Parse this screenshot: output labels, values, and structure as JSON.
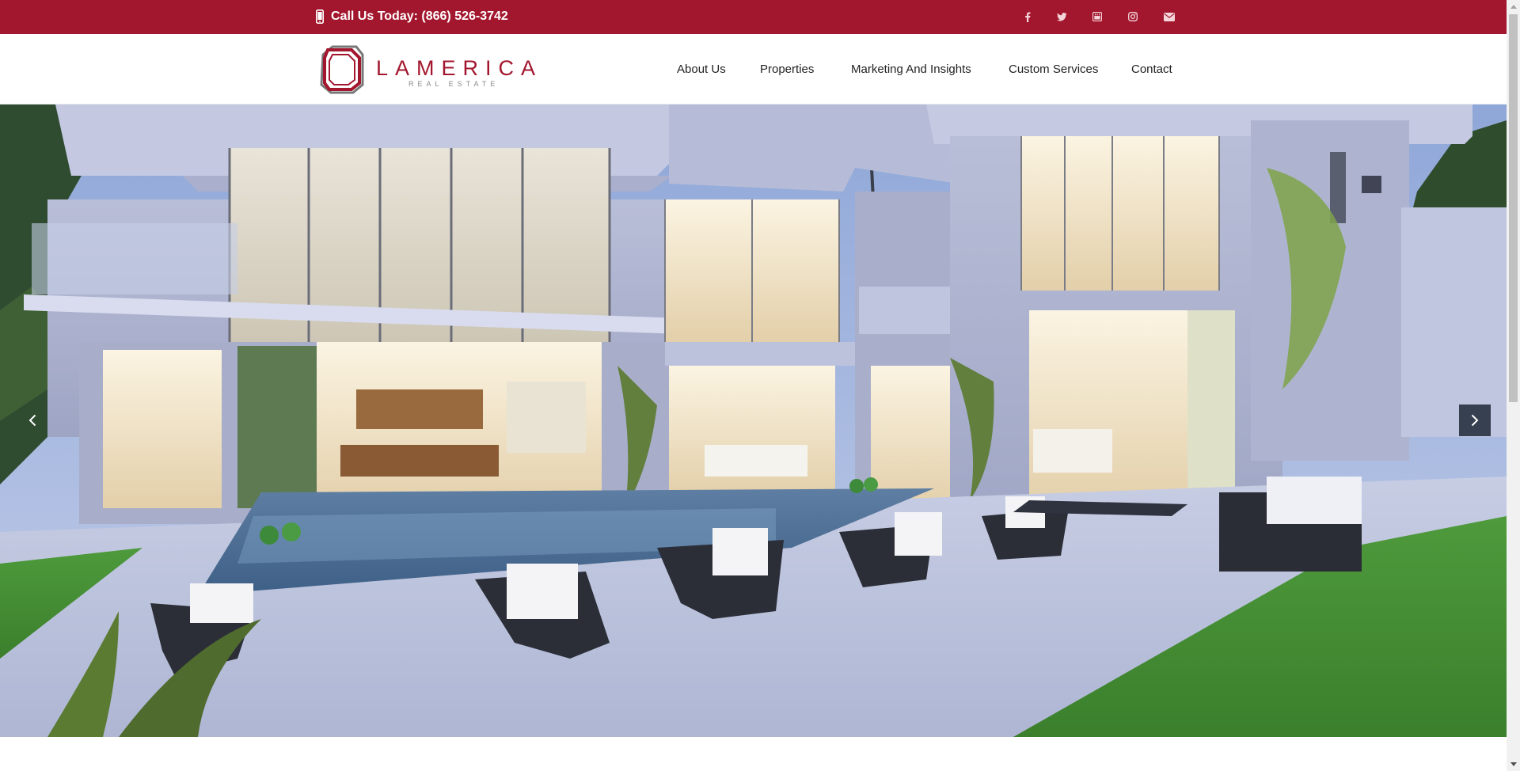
{
  "topbar": {
    "phone_icon": "mobile-phone-icon",
    "phone_text": "Call Us Today: (866) 526-3742",
    "social": [
      {
        "name": "facebook-icon",
        "label": "f"
      },
      {
        "name": "twitter-icon",
        "label": "twitter"
      },
      {
        "name": "youtube-icon",
        "label": "youtube"
      },
      {
        "name": "instagram-icon",
        "label": "instagram"
      },
      {
        "name": "email-icon",
        "label": "envelope"
      }
    ],
    "color": "#a3172e"
  },
  "logo": {
    "name": "LAMERICA",
    "tagline": "REAL ESTATE"
  },
  "nav": {
    "about": "About Us",
    "properties": "Properties",
    "marketing": "Marketing And Insights",
    "custom": "Custom Services",
    "contact": "Contact"
  },
  "hero": {
    "image": "modern-luxury-house-with-pool",
    "prev_icon": "chevron-left-icon",
    "next_icon": "chevron-right-icon"
  }
}
